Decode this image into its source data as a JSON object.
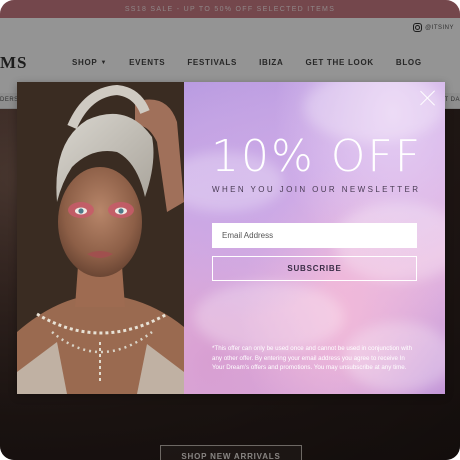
{
  "promo_bar": {
    "text": "SS18 SALE - UP TO 50% OFF SELECTED ITEMS"
  },
  "header": {
    "social_handle": "@ITSINY",
    "social_icon": "instagram-icon",
    "logo_partial": "MS",
    "nav": [
      {
        "label": "SHOP",
        "has_dropdown": true
      },
      {
        "label": "EVENTS"
      },
      {
        "label": "FESTIVALS"
      },
      {
        "label": "IBIZA"
      },
      {
        "label": "GET THE LOOK"
      },
      {
        "label": "BLOG"
      }
    ]
  },
  "strip": {
    "left_text": "DERS",
    "right_text": "T DA"
  },
  "hero": {
    "button_label": "SHOP NEW ARRIVALS"
  },
  "modal": {
    "title": "10% OFF",
    "subtitle": "WHEN YOU JOIN OUR NEWSLETTER",
    "email_placeholder": "Email Address",
    "subscribe_label": "SUBSCRIBE",
    "disclaimer": "*This offer can only be used once and cannot be used in conjunction with any other offer. By entering your email address you agree to receive In Your Dream's offers and promotions. You may unsubscribe at any time.",
    "close_icon": "close-icon"
  },
  "colors": {
    "promo_bar": "#c97b84",
    "overlay": "rgba(0,0,0,0.42)",
    "offer_gradient_start": "#b79ae0",
    "offer_gradient_end": "#e7b8e0"
  }
}
